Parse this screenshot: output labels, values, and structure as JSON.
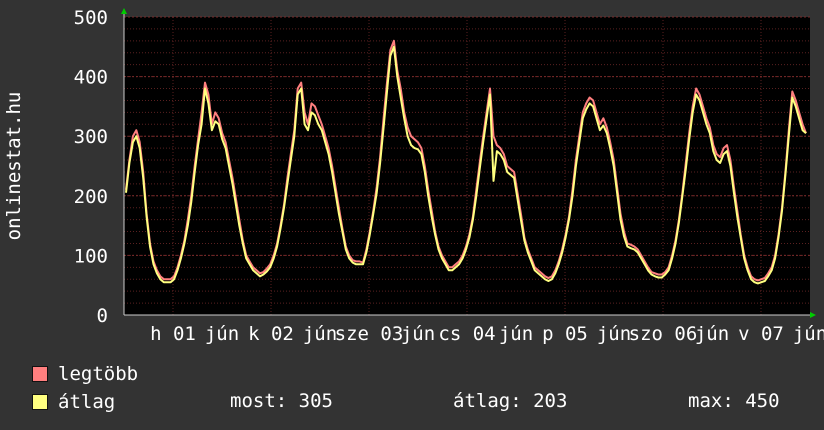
{
  "chart_data": {
    "type": "line",
    "ylabel": "onlinestat.hu",
    "ylim": [
      0,
      500
    ],
    "yticks": [
      0,
      100,
      200,
      300,
      400,
      500
    ],
    "xtick_labels": [
      "h 01",
      "jún",
      "k 02",
      "jún",
      "sze 03",
      "jún",
      "cs 04",
      "jún",
      "p 05",
      "jún",
      "szo 06",
      "jún",
      "v 07",
      "jún"
    ],
    "grid": true,
    "series": [
      {
        "name": "legtöbb",
        "color": "#ff7f7f",
        "values": [
          210,
          260,
          300,
          310,
          290,
          240,
          170,
          120,
          90,
          75,
          65,
          60,
          60,
          60,
          65,
          80,
          100,
          125,
          160,
          200,
          250,
          295,
          340,
          390,
          370,
          320,
          340,
          330,
          305,
          290,
          260,
          230,
          195,
          160,
          125,
          100,
          90,
          80,
          75,
          70,
          72,
          78,
          85,
          100,
          120,
          150,
          185,
          230,
          270,
          310,
          380,
          390,
          340,
          320,
          355,
          350,
          335,
          320,
          300,
          280,
          250,
          215,
          180,
          145,
          115,
          100,
          92,
          90,
          90,
          88,
          110,
          140,
          175,
          215,
          265,
          330,
          390,
          445,
          460,
          410,
          380,
          340,
          315,
          300,
          295,
          290,
          280,
          250,
          210,
          175,
          140,
          115,
          100,
          90,
          80,
          80,
          85,
          90,
          100,
          115,
          135,
          165,
          210,
          255,
          300,
          340,
          380,
          300,
          285,
          280,
          270,
          250,
          245,
          240,
          205,
          170,
          130,
          110,
          95,
          80,
          75,
          70,
          65,
          62,
          65,
          75,
          90,
          110,
          135,
          165,
          210,
          260,
          300,
          340,
          355,
          365,
          360,
          340,
          320,
          330,
          315,
          290,
          260,
          215,
          170,
          140,
          120,
          118,
          115,
          110,
          100,
          90,
          80,
          72,
          70,
          68,
          68,
          72,
          80,
          100,
          125,
          160,
          205,
          255,
          305,
          350,
          380,
          370,
          350,
          330,
          315,
          285,
          270,
          265,
          280,
          285,
          260,
          215,
          175,
          135,
          100,
          80,
          65,
          60,
          58,
          60,
          62,
          70,
          80,
          100,
          135,
          180,
          240,
          310,
          375,
          360,
          340,
          320,
          305
        ]
      },
      {
        "name": "átlag",
        "color": "#ffff80",
        "values": [
          205,
          255,
          290,
          300,
          280,
          230,
          165,
          115,
          85,
          70,
          60,
          55,
          55,
          55,
          60,
          75,
          95,
          120,
          150,
          190,
          240,
          285,
          320,
          380,
          355,
          310,
          325,
          320,
          295,
          280,
          250,
          220,
          185,
          150,
          120,
          95,
          85,
          75,
          70,
          65,
          68,
          73,
          80,
          95,
          115,
          145,
          180,
          220,
          260,
          300,
          370,
          380,
          320,
          310,
          340,
          335,
          320,
          310,
          290,
          270,
          240,
          205,
          170,
          140,
          110,
          95,
          88,
          85,
          85,
          85,
          105,
          135,
          170,
          205,
          255,
          315,
          375,
          435,
          450,
          400,
          365,
          330,
          300,
          285,
          280,
          278,
          270,
          240,
          200,
          165,
          135,
          110,
          95,
          85,
          75,
          75,
          80,
          85,
          95,
          110,
          130,
          160,
          200,
          245,
          290,
          330,
          370,
          225,
          275,
          270,
          260,
          240,
          235,
          230,
          195,
          160,
          125,
          105,
          90,
          75,
          70,
          65,
          60,
          57,
          60,
          70,
          85,
          105,
          130,
          160,
          200,
          250,
          290,
          330,
          345,
          355,
          350,
          330,
          310,
          318,
          305,
          280,
          250,
          205,
          160,
          132,
          115,
          112,
          110,
          105,
          95,
          85,
          75,
          68,
          65,
          63,
          63,
          68,
          75,
          95,
          120,
          155,
          200,
          245,
          295,
          340,
          370,
          360,
          340,
          320,
          305,
          275,
          260,
          255,
          270,
          275,
          250,
          205,
          165,
          130,
          95,
          75,
          60,
          55,
          53,
          55,
          57,
          65,
          75,
          95,
          130,
          175,
          235,
          300,
          365,
          350,
          330,
          310,
          305
        ]
      }
    ]
  },
  "legend": {
    "items": [
      {
        "label": "legtöbb",
        "color": "#ff7f7f"
      },
      {
        "label": "átlag",
        "color": "#ffff80"
      }
    ]
  },
  "stats": {
    "most": "most: 305",
    "atlag": "átlag: 203",
    "max": "max: 450"
  }
}
